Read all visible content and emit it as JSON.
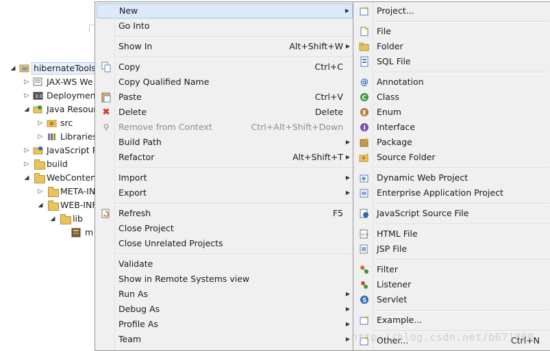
{
  "tree": {
    "items": [
      {
        "label": "hibernateTools",
        "arrow": "◢",
        "icon": "project-icon"
      },
      {
        "label": "JAX-WS We",
        "arrow": "▷",
        "icon": "webservice-icon"
      },
      {
        "label": "Deployment",
        "arrow": "▷",
        "icon": "deployment-icon"
      },
      {
        "label": "Java Resour",
        "arrow": "◢",
        "icon": "java-resources-icon"
      },
      {
        "label": "src",
        "arrow": "▷",
        "icon": "package-folder-icon"
      },
      {
        "label": "Libraries",
        "arrow": "▷",
        "icon": "libraries-icon"
      },
      {
        "label": "JavaScript R",
        "arrow": "▷",
        "icon": "javascript-icon"
      },
      {
        "label": "build",
        "arrow": "▷",
        "icon": "folder-icon"
      },
      {
        "label": "WebConten",
        "arrow": "◢",
        "icon": "folder-icon"
      },
      {
        "label": "META-IN",
        "arrow": "▷",
        "icon": "folder-icon"
      },
      {
        "label": "WEB-INF",
        "arrow": "◢",
        "icon": "folder-icon"
      },
      {
        "label": "lib",
        "arrow": "◢",
        "icon": "folder-icon"
      },
      {
        "label": "m",
        "arrow": "",
        "icon": "jar-icon"
      }
    ]
  },
  "context_menu": {
    "items": [
      {
        "label": "New",
        "accel": "",
        "submenu": true,
        "icon": "",
        "disabled": false,
        "highlight": true
      },
      {
        "label": "Go Into",
        "accel": "",
        "submenu": false,
        "icon": ""
      },
      {
        "label": "Show In",
        "accel": "Alt+Shift+W",
        "submenu": true,
        "icon": ""
      },
      {
        "label": "Copy",
        "accel": "Ctrl+C",
        "submenu": false,
        "icon": "copy-icon"
      },
      {
        "label": "Copy Qualified Name",
        "accel": "",
        "submenu": false,
        "icon": ""
      },
      {
        "label": "Paste",
        "accel": "Ctrl+V",
        "submenu": false,
        "icon": "paste-icon"
      },
      {
        "label": "Delete",
        "accel": "Delete",
        "submenu": false,
        "icon": "delete-icon"
      },
      {
        "label": "Remove from Context",
        "accel": "Ctrl+Alt+Shift+Down",
        "submenu": false,
        "icon": "remove-context-icon",
        "disabled": true
      },
      {
        "label": "Build Path",
        "accel": "",
        "submenu": true,
        "icon": ""
      },
      {
        "label": "Refactor",
        "accel": "Alt+Shift+T",
        "submenu": true,
        "icon": ""
      },
      {
        "label": "Import",
        "accel": "",
        "submenu": true,
        "icon": ""
      },
      {
        "label": "Export",
        "accel": "",
        "submenu": true,
        "icon": ""
      },
      {
        "label": "Refresh",
        "accel": "F5",
        "submenu": false,
        "icon": "refresh-icon"
      },
      {
        "label": "Close Project",
        "accel": "",
        "submenu": false,
        "icon": ""
      },
      {
        "label": "Close Unrelated Projects",
        "accel": "",
        "submenu": false,
        "icon": ""
      },
      {
        "label": "Validate",
        "accel": "",
        "submenu": false,
        "icon": ""
      },
      {
        "label": "Show in Remote Systems view",
        "accel": "",
        "submenu": false,
        "icon": ""
      },
      {
        "label": "Run As",
        "accel": "",
        "submenu": true,
        "icon": ""
      },
      {
        "label": "Debug As",
        "accel": "",
        "submenu": true,
        "icon": ""
      },
      {
        "label": "Profile As",
        "accel": "",
        "submenu": true,
        "icon": ""
      },
      {
        "label": "Team",
        "accel": "",
        "submenu": true,
        "icon": ""
      }
    ]
  },
  "new_submenu": {
    "items": [
      {
        "label": "Project...",
        "accel": "",
        "icon": "new-project-icon"
      },
      {
        "label": "File",
        "accel": "",
        "icon": "new-file-icon"
      },
      {
        "label": "Folder",
        "accel": "",
        "icon": "new-folder-icon"
      },
      {
        "label": "SQL File",
        "accel": "",
        "icon": "sql-file-icon"
      },
      {
        "label": "Annotation",
        "accel": "",
        "icon": "annotation-icon"
      },
      {
        "label": "Class",
        "accel": "",
        "icon": "class-icon"
      },
      {
        "label": "Enum",
        "accel": "",
        "icon": "enum-icon"
      },
      {
        "label": "Interface",
        "accel": "",
        "icon": "interface-icon"
      },
      {
        "label": "Package",
        "accel": "",
        "icon": "package-icon"
      },
      {
        "label": "Source Folder",
        "accel": "",
        "icon": "source-folder-icon"
      },
      {
        "label": "Dynamic Web Project",
        "accel": "",
        "icon": "web-project-icon"
      },
      {
        "label": "Enterprise Application Project",
        "accel": "",
        "icon": "ear-project-icon"
      },
      {
        "label": "JavaScript Source File",
        "accel": "",
        "icon": "javascript-file-icon"
      },
      {
        "label": "HTML File",
        "accel": "",
        "icon": "html-file-icon"
      },
      {
        "label": "JSP File",
        "accel": "",
        "icon": "jsp-file-icon"
      },
      {
        "label": "Filter",
        "accel": "",
        "icon": "filter-icon"
      },
      {
        "label": "Listener",
        "accel": "",
        "icon": "listener-icon"
      },
      {
        "label": "Servlet",
        "accel": "",
        "icon": "servlet-icon"
      },
      {
        "label": "Example...",
        "accel": "",
        "icon": "example-icon"
      },
      {
        "label": "Other...",
        "accel": "Ctrl+N",
        "icon": "other-icon"
      }
    ]
  },
  "watermark": "http://blog.csdn.net/b671000",
  "colors": {
    "menu_bg": "#f0f0f0",
    "highlight_bg": "#dde9f7",
    "highlight_border": "#a8c8ec"
  }
}
